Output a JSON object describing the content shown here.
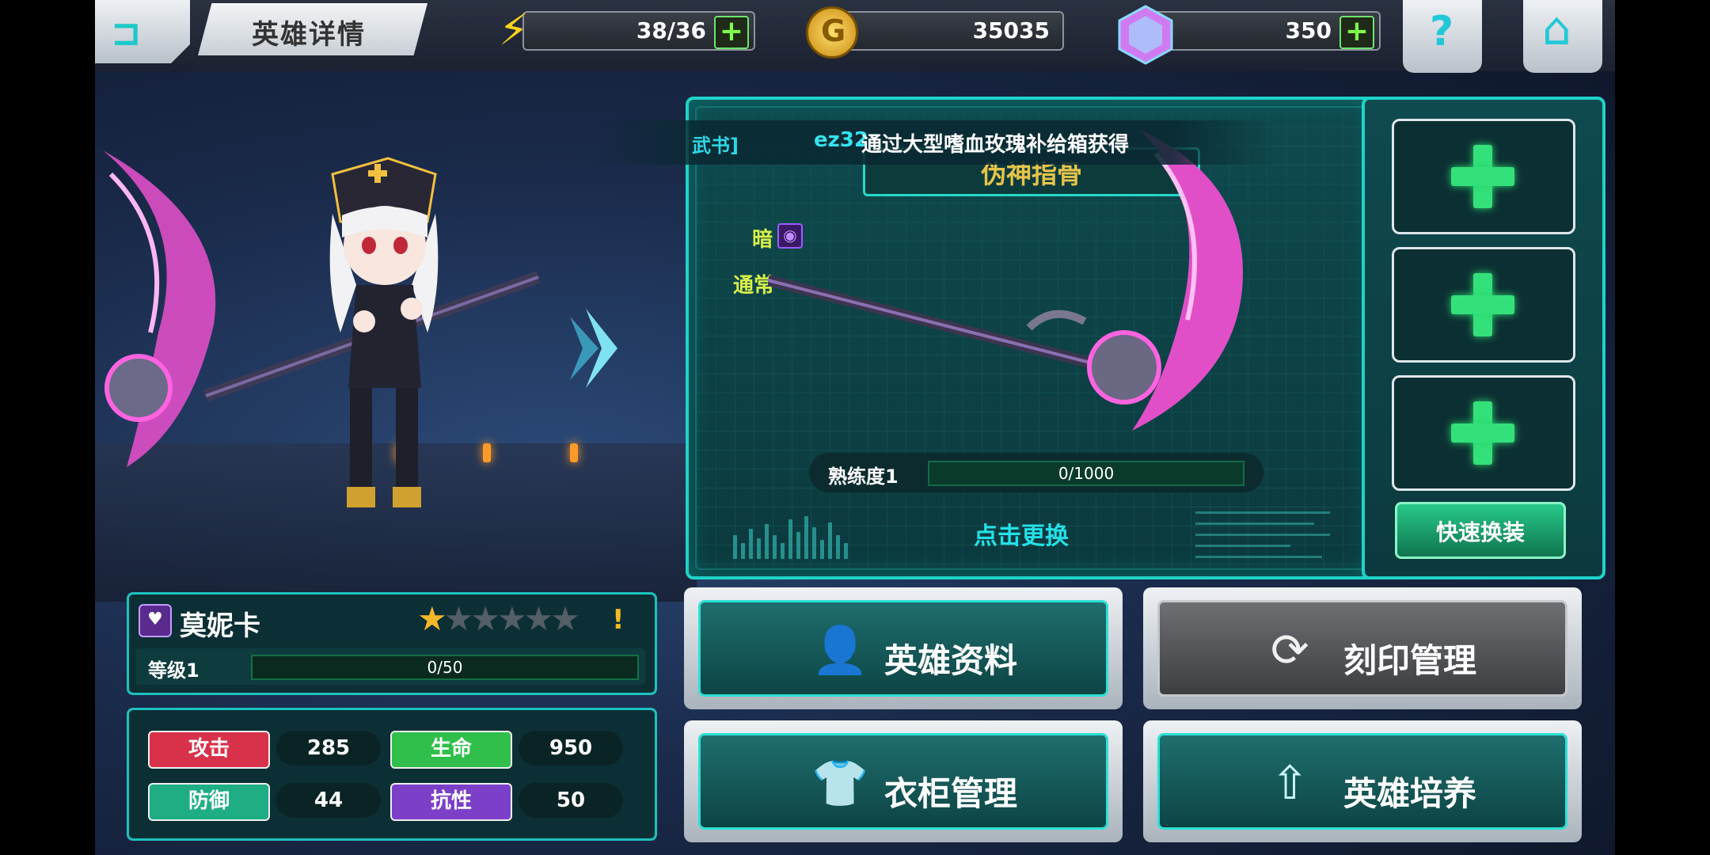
{
  "header": {
    "title": "英雄详情",
    "stamina": "38/36",
    "gold": "35035",
    "gems": "350"
  },
  "toast": {
    "source_fragment": "武书]",
    "user": "ez32",
    "message": "通过大型嗜血玫瑰补给箱获得"
  },
  "weapon": {
    "name": "伪神指骨",
    "element": "暗",
    "type": "通常",
    "proficiency_label": "熟练度1",
    "proficiency_value": "0/1000",
    "change_label": "点击更换"
  },
  "accessory_slots": {
    "quick_equip_label": "快速换装"
  },
  "hero": {
    "name": "莫妮卡",
    "stars_filled": 1,
    "stars_total": 6,
    "level_label": "等级1",
    "level_value": "0/50",
    "stats": {
      "attack_label": "攻击",
      "attack": "285",
      "hp_label": "生命",
      "hp": "950",
      "defense_label": "防御",
      "defense": "44",
      "resist_label": "抗性",
      "resist": "50"
    }
  },
  "buttons": {
    "hero_info": "英雄资料",
    "imprint": "刻印管理",
    "wardrobe": "衣柜管理",
    "train": "英雄培养"
  },
  "colors": {
    "accent": "#20d2c8",
    "attack": "#d8324a",
    "hp": "#2fbf4a",
    "defense": "#1fae84",
    "resist": "#7c3fc8"
  }
}
